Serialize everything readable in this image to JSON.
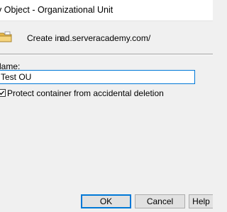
{
  "window": {
    "title": "v Object - Organizational Unit"
  },
  "header": {
    "icon": "folder-icon",
    "create_in_label": "Create in:",
    "create_in_value": "ad.serveracademy.com/"
  },
  "form": {
    "name_label": "lame:",
    "name_value": "Test OU",
    "protect_checked": true,
    "protect_label": "Protect container from accidental deletion"
  },
  "buttons": {
    "ok": "OK",
    "cancel": "Cancel",
    "help": "Help"
  },
  "colors": {
    "accent": "#0078d7",
    "folder": "#e8b84a"
  }
}
